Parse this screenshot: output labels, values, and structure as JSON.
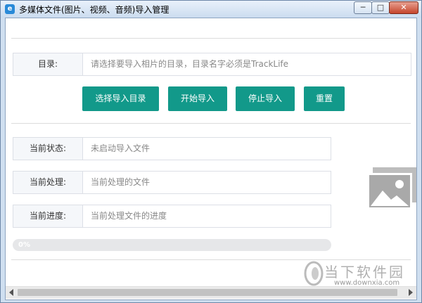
{
  "window": {
    "title": "多媒体文件(图片、视频、音频)导入管理",
    "app_icon": "e",
    "controls": {
      "minimize": "─",
      "maximize": "□",
      "close": "✕"
    }
  },
  "directory": {
    "label": "目录:",
    "placeholder": "请选择要导入相片的目录，目录名字必须是TrackLife"
  },
  "buttons": {
    "select": "选择导入目录",
    "start": "开始导入",
    "stop": "停止导入",
    "reset": "重置"
  },
  "status": {
    "state_label": "当前状态:",
    "state_value": "未启动导入文件",
    "processing_label": "当前处理:",
    "processing_value": "当前处理的文件",
    "progress_label": "当前进度:",
    "progress_value": "当前处理文件的进度"
  },
  "progress": {
    "percent": 0,
    "text": "0%"
  },
  "watermark": {
    "text": "当下软件园",
    "url": "www.downxia.com"
  },
  "colors": {
    "accent": "#12998a",
    "field_label_bg": "#f5f7fa"
  }
}
